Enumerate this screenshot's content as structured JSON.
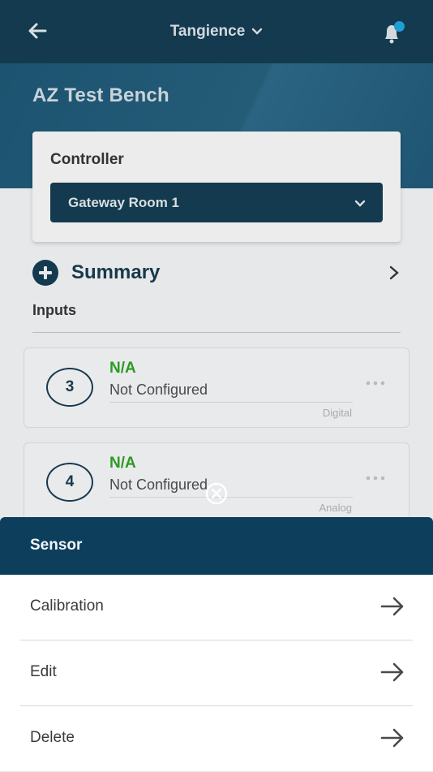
{
  "topbar": {
    "organization": "Tangience",
    "icons": {
      "back": "arrow-left-icon",
      "dropdown": "chevron-down-icon",
      "bell": "bell-icon"
    },
    "accent": "#1f9ed6"
  },
  "page": {
    "title": "AZ Test Bench"
  },
  "controller": {
    "label": "Controller",
    "selected": "Gateway Room 1"
  },
  "summary": {
    "label": "Summary"
  },
  "inputs": {
    "label": "Inputs",
    "items": [
      {
        "number": "3",
        "value": "N/A",
        "status": "Not Configured",
        "type": "Digital"
      },
      {
        "number": "4",
        "value": "N/A",
        "status": "Not Configured",
        "type": "Analog"
      }
    ]
  },
  "sheet": {
    "title": "Sensor",
    "items": [
      {
        "label": "Calibration"
      },
      {
        "label": "Edit"
      },
      {
        "label": "Delete"
      }
    ]
  },
  "colors": {
    "navy": "#133a4e",
    "sheet_header": "#0d3f5c",
    "status_green": "#2c9a24"
  }
}
